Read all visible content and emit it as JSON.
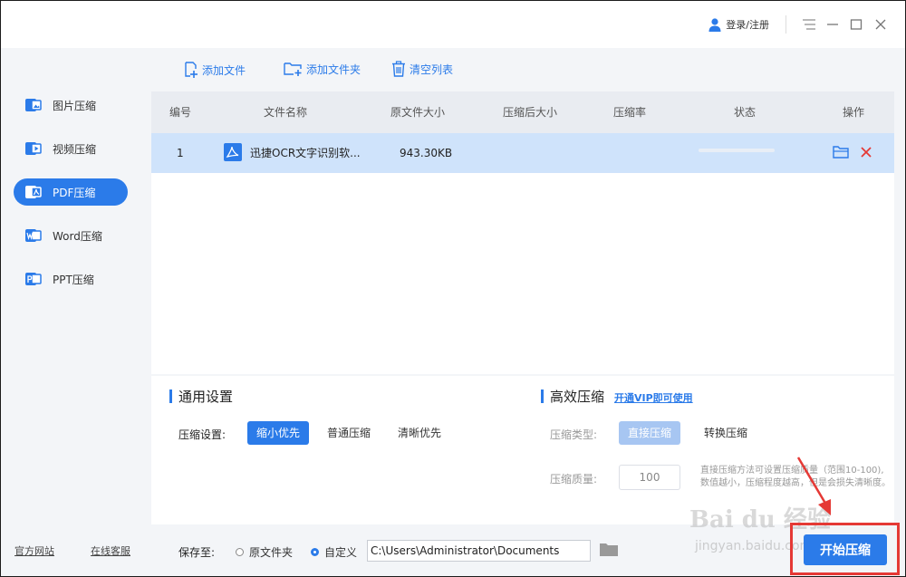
{
  "header": {
    "login_label": "登录/注册"
  },
  "sidebar": {
    "items": [
      {
        "label": "图片压缩",
        "icon": "image-compress-icon",
        "active": false
      },
      {
        "label": "视频压缩",
        "icon": "video-compress-icon",
        "active": false
      },
      {
        "label": "PDF压缩",
        "icon": "pdf-compress-icon",
        "active": true
      },
      {
        "label": "Word压缩",
        "icon": "word-compress-icon",
        "active": false
      },
      {
        "label": "PPT压缩",
        "icon": "ppt-compress-icon",
        "active": false
      }
    ],
    "footer": {
      "official_site": "官方网站",
      "online_support": "在线客服"
    }
  },
  "toolbar": {
    "add_file": "添加文件",
    "add_folder": "添加文件夹",
    "clear_list": "清空列表"
  },
  "table": {
    "headers": [
      "编号",
      "文件名称",
      "原文件大小",
      "压缩后大小",
      "压缩率",
      "状态",
      "操作"
    ],
    "rows": [
      {
        "index": "1",
        "name": "迅捷OCR文字识别软...",
        "original_size": "943.30KB",
        "compressed_size": "",
        "ratio": "",
        "progress": 0
      }
    ]
  },
  "settings": {
    "general_title": "通用设置",
    "compress_setting_label": "压缩设置:",
    "options": [
      "缩小优先",
      "普通压缩",
      "清晰优先"
    ],
    "selected_option": "缩小优先",
    "efficient_title": "高效压缩",
    "vip_link": "开通VIP即可使用",
    "type_label": "压缩类型:",
    "type_options": [
      "直接压缩",
      "转换压缩"
    ],
    "quality_label": "压缩质量:",
    "quality_value": "100",
    "note_line1": "直接压缩方法可设置压缩质量（范围10-100),",
    "note_line2": "数值越小，压缩程度越高，但是会损失清晰度。"
  },
  "bottom": {
    "save_to_label": "保存至:",
    "radio_original": "原文件夹",
    "radio_custom": "自定义",
    "path_value": "C:\\Users\\Administrator\\Documents",
    "start_button": "开始压缩"
  },
  "watermark": {
    "brand": "Bai du 经验",
    "url": "jingyan.baidu.com"
  },
  "colors": {
    "accent": "#2b7be9",
    "selected_row": "#cfe3fb",
    "delete": "#e53935",
    "annotation": "#e53935"
  }
}
